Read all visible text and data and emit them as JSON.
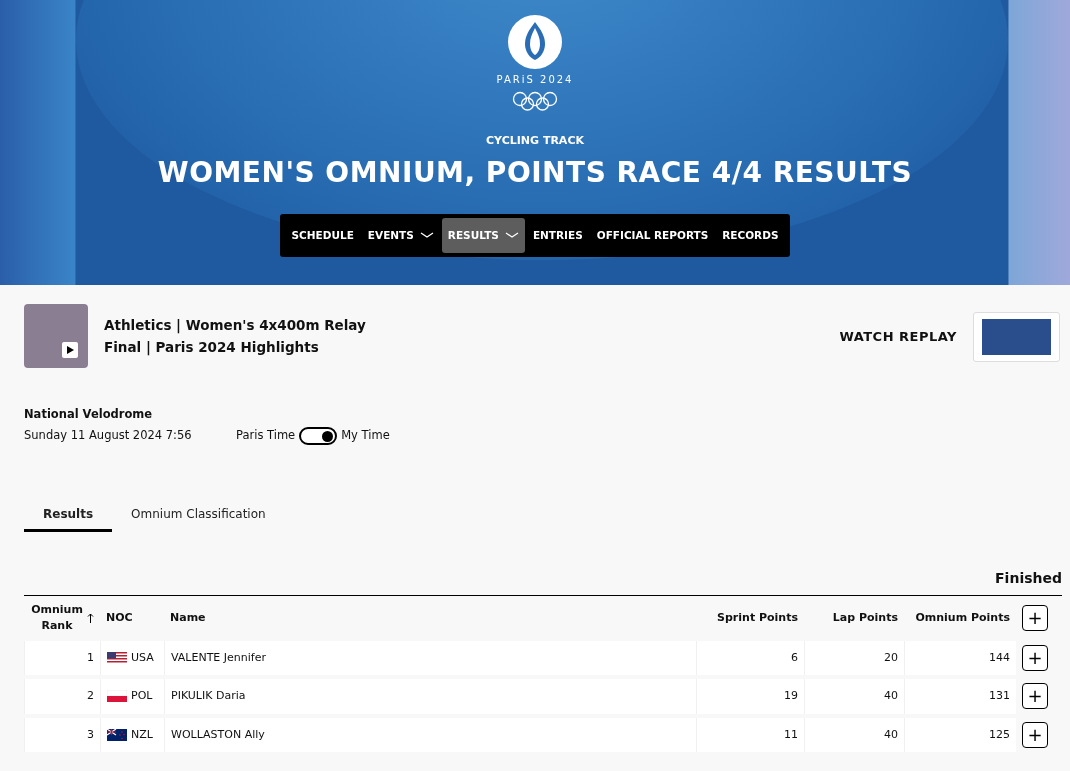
{
  "header": {
    "logo_text": "PARiS 2024",
    "sport": "CYCLING TRACK",
    "title": "WOMEN'S OMNIUM, POINTS RACE 4/4 RESULTS",
    "nav": [
      {
        "label": "SCHEDULE",
        "dropdown": false,
        "selected": false
      },
      {
        "label": "EVENTS",
        "dropdown": true,
        "selected": false
      },
      {
        "label": "RESULTS",
        "dropdown": true,
        "selected": true
      },
      {
        "label": "ENTRIES",
        "dropdown": false,
        "selected": false
      },
      {
        "label": "OFFICIAL REPORTS",
        "dropdown": false,
        "selected": false
      },
      {
        "label": "RECORDS",
        "dropdown": false,
        "selected": false
      }
    ]
  },
  "video": {
    "title_line_1": "Athletics | Women's 4x400m Relay",
    "title_line_2": "Final | Paris 2024 Highlights",
    "watch_label": "WATCH REPLAY"
  },
  "event": {
    "venue": "National Velodrome",
    "date": "Sunday 11 August 2024 7:56",
    "time_toggle": {
      "left_label": "Paris Time",
      "right_label": "My Time",
      "on": true
    }
  },
  "tabs": [
    {
      "label": "Results",
      "selected": true
    },
    {
      "label": "Omnium Classification",
      "selected": false
    }
  ],
  "status": "Finished",
  "table": {
    "columns": [
      {
        "label": "Omnium Rank",
        "sorted": true
      },
      {
        "label": "NOC",
        "sorted": false
      },
      {
        "label": "Name",
        "sorted": false
      },
      {
        "label": "Sprint Points",
        "sorted": false
      },
      {
        "label": "Lap Points",
        "sorted": false
      },
      {
        "label": "Omnium Points",
        "sorted": false
      }
    ],
    "expand_symbol": "+",
    "rows": [
      {
        "rank": "1",
        "noc": "USA",
        "name": "VALENTE Jennifer",
        "sprint": "6",
        "lap": "20",
        "omnium": "144",
        "expand": "+"
      },
      {
        "rank": "2",
        "noc": "POL",
        "name": "PIKULIK Daria",
        "sprint": "19",
        "lap": "40",
        "omnium": "131",
        "expand": "+"
      },
      {
        "rank": "3",
        "noc": "NZL",
        "name": "WOLLASTON Ally",
        "sprint": "11",
        "lap": "40",
        "omnium": "125",
        "expand": "+"
      }
    ]
  }
}
